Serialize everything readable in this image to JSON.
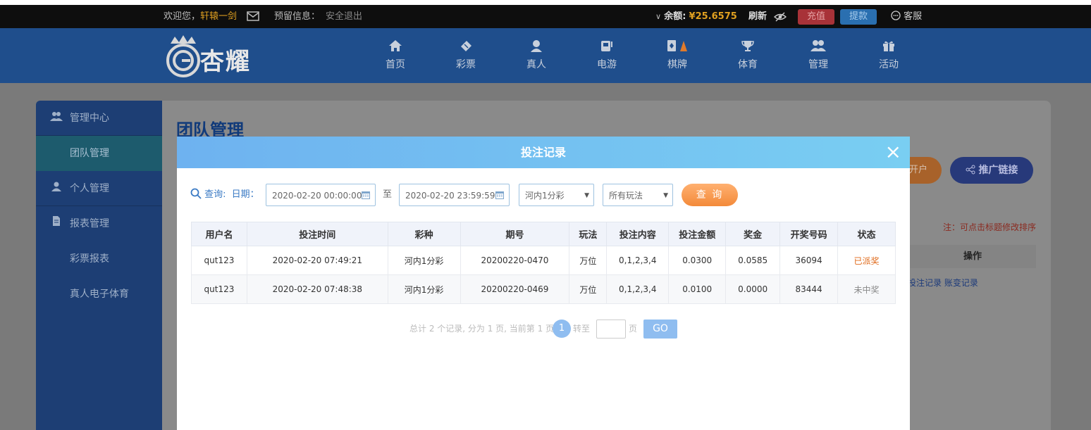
{
  "topbar": {
    "welcome_prefix": "欢迎您，",
    "username": "轩辕一剑",
    "reserved_info_label": "预留信息：",
    "logout": "安全退出",
    "balance_label": "余额:",
    "balance_value": "¥25.6575",
    "refresh": "刷新",
    "recharge": "充值",
    "withdraw": "提款",
    "customer_service": "客服"
  },
  "header": {
    "logo_text": "杏耀",
    "nav": [
      "首页",
      "彩票",
      "真人",
      "电游",
      "棋牌",
      "体育",
      "管理",
      "活动"
    ]
  },
  "sidebar": {
    "section_admin": "管理中心",
    "item_team": "团队管理",
    "section_personal": "个人管理",
    "section_reports": "报表管理",
    "item_lottery_report": "彩票报表",
    "item_live_report": "真人电子体育"
  },
  "panel": {
    "title": "团队管理",
    "open_account_stub": "开户",
    "promo_link": "推广链接",
    "note": "注：可点击标题修改排序",
    "ops_header": "操作",
    "bet_records_link": "投注记录",
    "account_change_link": "账变记录"
  },
  "modal": {
    "title": "投注记录",
    "close": "×",
    "query_label": "查询:",
    "date_label": "日期：",
    "date_from": "2020-02-20 00:00:00",
    "date_to_label": "至",
    "date_to": "2020-02-20 23:59:59",
    "lottery_select": "河内1分彩",
    "play_select": "所有玩法",
    "query_button": "查 询",
    "columns": [
      "用户名",
      "投注时间",
      "彩种",
      "期号",
      "玩法",
      "投注内容",
      "投注金额",
      "奖金",
      "开奖号码",
      "状态"
    ],
    "rows": [
      [
        "qut123",
        "2020-02-20 07:49:21",
        "河内1分彩",
        "20200220-0470",
        "万位",
        "0,1,2,3,4",
        "0.0300",
        "0.0585",
        "36094",
        "已派奖"
      ],
      [
        "qut123",
        "2020-02-20 07:48:38",
        "河内1分彩",
        "20200220-0469",
        "万位",
        "0,1,2,3,4",
        "0.0100",
        "0.0000",
        "83444",
        "未中奖"
      ]
    ],
    "pagination": {
      "summary": "总计 2 个记录, 分为 1 页, 当前第 1 页",
      "current_page": "1",
      "goto_label": "转至",
      "page_unit": "页",
      "go_button": "GO"
    }
  },
  "colors": {
    "status_paid": "#e06a1a",
    "status_lost": "#888888",
    "balance": "#e0a020"
  }
}
